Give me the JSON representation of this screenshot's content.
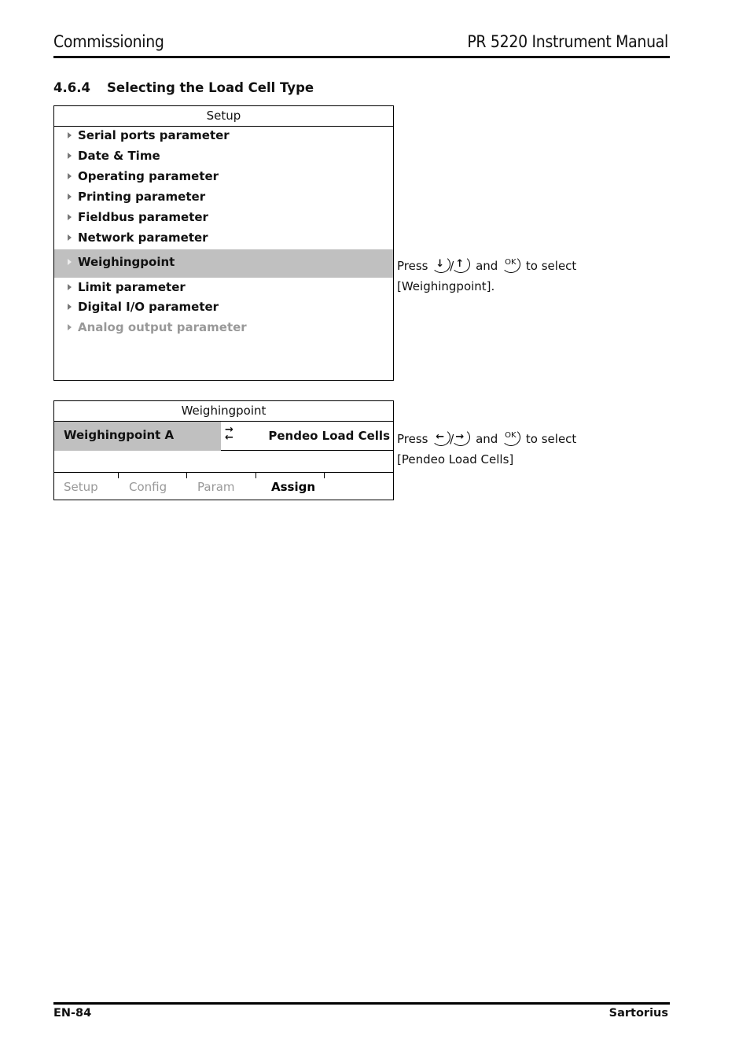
{
  "header": {
    "section_name": "Commissioning",
    "manual_title": "PR 5220 Instrument Manual"
  },
  "section": {
    "number": "4.6.4",
    "title": "Selecting the Load Cell Type"
  },
  "setup_screen": {
    "title": "Setup",
    "items": [
      {
        "label": "Serial ports parameter",
        "state": "normal"
      },
      {
        "label": "Date & Time",
        "state": "normal"
      },
      {
        "label": "Operating parameter",
        "state": "normal"
      },
      {
        "label": "Printing parameter",
        "state": "normal"
      },
      {
        "label": "Fieldbus parameter",
        "state": "normal"
      },
      {
        "label": "Network parameter",
        "state": "normal"
      },
      {
        "label": "Weighingpoint",
        "state": "selected"
      },
      {
        "label": "Limit parameter",
        "state": "normal"
      },
      {
        "label": "Digital I/O parameter",
        "state": "normal"
      },
      {
        "label": "Analog output parameter",
        "state": "disabled"
      }
    ],
    "instruction": {
      "press": "Press",
      "key1": "↓",
      "key2": "↑",
      "and": "and",
      "ok": "OK",
      "to_select": "to select",
      "target": "[Weighingpoint]."
    }
  },
  "weighingpoint_screen": {
    "title": "Weighingpoint",
    "row_label": "Weighingpoint A",
    "swap_icon": "⇄",
    "row_value": "Pendeo Load Cells",
    "tabs": [
      {
        "label": "Setup",
        "active": false
      },
      {
        "label": "Config",
        "active": false
      },
      {
        "label": "Param",
        "active": false
      },
      {
        "label": "Assign",
        "active": true
      }
    ],
    "instruction": {
      "press": "Press",
      "key1": "←",
      "key2": "→",
      "and": "and",
      "ok": "OK",
      "to_select": "to select",
      "target": "[Pendeo Load Cells]"
    }
  },
  "footer": {
    "page": "EN-84",
    "brand": "Sartorius"
  }
}
